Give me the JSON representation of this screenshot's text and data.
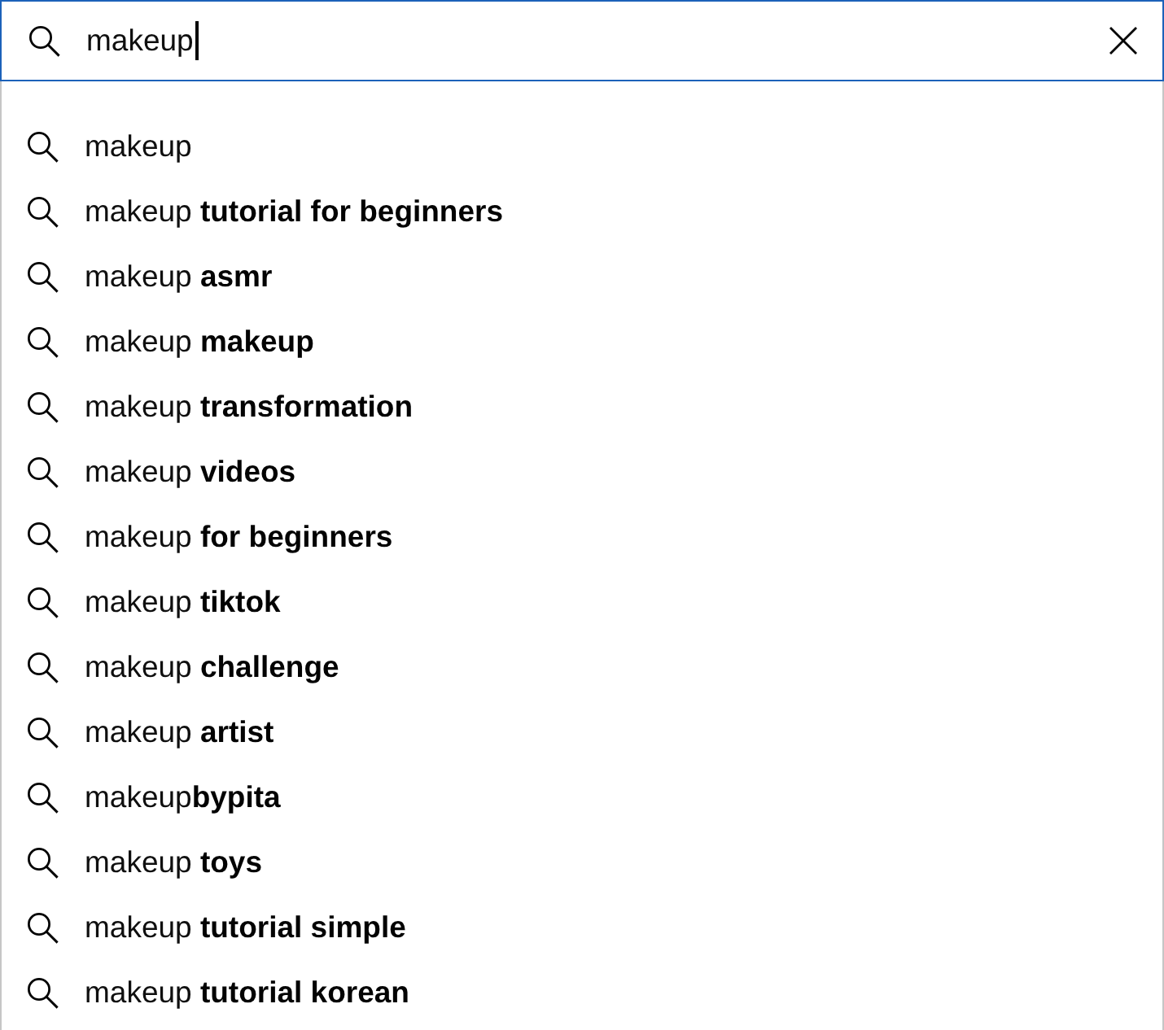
{
  "search": {
    "value": "makeup",
    "focused": true
  },
  "suggestions": [
    "makeup",
    "makeup **tutorial for beginners**",
    "makeup **asmr**",
    "makeup **makeup**",
    "makeup **transformation**",
    "makeup **videos**",
    "makeup **for beginners**",
    "makeup **tiktok**",
    "makeup **challenge**",
    "makeup **artist**",
    "makeup**bypita**",
    "makeup **toys**",
    "makeup **tutorial simple**",
    "makeup **tutorial korean**"
  ]
}
